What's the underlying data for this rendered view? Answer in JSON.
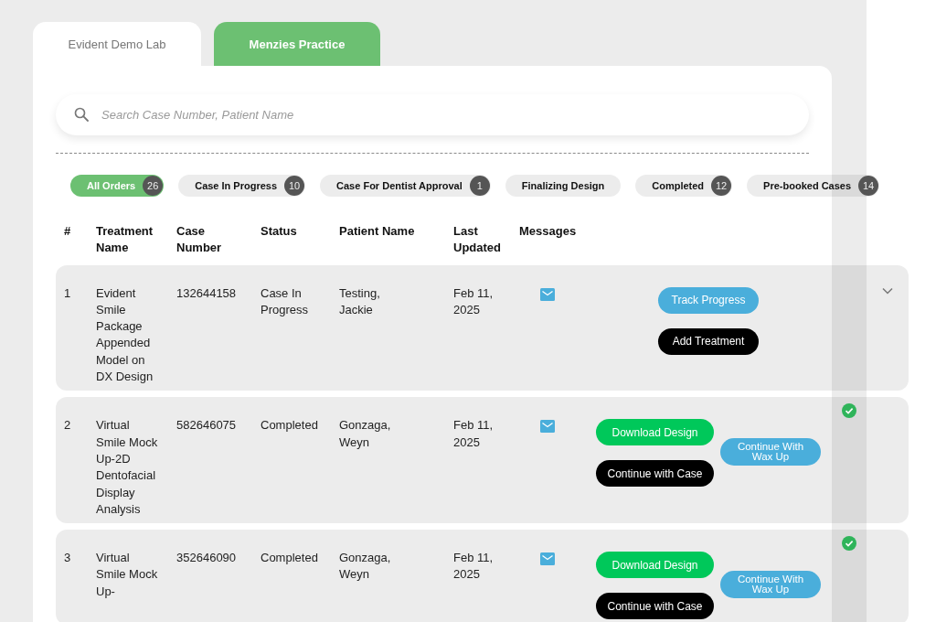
{
  "tabs": [
    {
      "label": "Evident Demo Lab",
      "selected": false
    },
    {
      "label": "Menzies Practice",
      "selected": true
    }
  ],
  "search": {
    "placeholder": "Search Case Number, Patient Name"
  },
  "filters": [
    {
      "label": "All Orders",
      "count": "26",
      "selected": true
    },
    {
      "label": "Case In Progress",
      "count": "10",
      "selected": false
    },
    {
      "label": "Case For Dentist Approval",
      "count": "1",
      "selected": false
    },
    {
      "label": "Finalizing Design",
      "selected": false
    },
    {
      "label": "Completed",
      "count": "12",
      "selected": false
    },
    {
      "label": "Pre-booked Cases",
      "count": "14",
      "selected": false
    }
  ],
  "table": {
    "columns": [
      "#",
      "Treatment Name",
      "Case Number",
      "Status",
      "Patient Name",
      "Last Updated",
      "Messages"
    ],
    "rows": [
      {
        "number": "1",
        "treatment": "Evident Smile Package Appended Model on DX Design",
        "case_number": "132644158",
        "status": "Case In Progress",
        "patient": "Testing, Jackie",
        "last_updated": "Feb 11, 2025",
        "buttons": [
          {
            "label": "Track Progress",
            "kind": "track"
          },
          {
            "label": "Add Treatment",
            "kind": "add"
          }
        ],
        "kind": "expand"
      },
      {
        "number": "2",
        "treatment": "Virtual Smile Mock Up-2D Dentofacial Display Analysis",
        "case_number": "582646075",
        "status": "Completed",
        "patient": "Gonzaga, Weyn",
        "last_updated": "Feb 11, 2025",
        "buttons": [
          {
            "label": "Download Design",
            "kind": "download"
          },
          {
            "label": "Continue with Case",
            "kind": "continue"
          }
        ],
        "side_button": {
          "label": "Continue With Wax Up",
          "kind": "wax_up"
        },
        "kind": "done"
      },
      {
        "number": "3",
        "treatment": "Virtual Smile Mock Up-",
        "case_number": "352646090",
        "status": "Completed",
        "patient": "Gonzaga, Weyn",
        "last_updated": "Feb 11, 2025",
        "buttons": [
          {
            "label": "Download Design",
            "kind": "download"
          },
          {
            "label": "Continue with Case",
            "kind": "continue"
          }
        ],
        "side_button": {
          "label": "Continue With Wax Up",
          "kind": "wax_up"
        },
        "kind": "done"
      }
    ]
  }
}
